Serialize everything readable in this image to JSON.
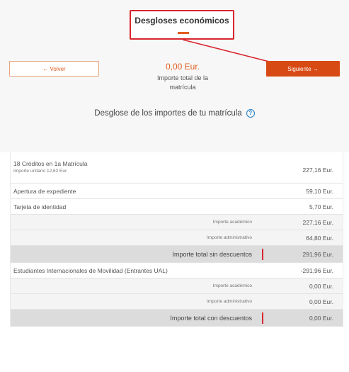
{
  "step": {
    "title": "Desgloses económicos"
  },
  "actions": {
    "back_label": "← Volver",
    "next_label": "Siguiente →"
  },
  "summary": {
    "total_amount": "0,00 Eur.",
    "total_caption": "Importe total de la matrícula"
  },
  "breakdown": {
    "title": "Desglose de los importes de tu matrícula",
    "help_glyph": "?",
    "rows": [
      {
        "label": "18 Créditos en 1a Matrícula",
        "sublabel": "Importe unitario 12,62 Eur.",
        "amount": "227,16 Eur."
      },
      {
        "label": "Apertura de expediente",
        "amount": "59,10 Eur."
      },
      {
        "label": "Tarjeta de identidad",
        "amount": "5,70 Eur."
      },
      {
        "label": "Importe académico",
        "amount": "227,16 Eur."
      },
      {
        "label": "Importe administrativo",
        "amount": "64,80 Eur."
      },
      {
        "label": "Importe total sin descuentos",
        "amount": "291,96 Eur."
      },
      {
        "label": "Estudiantes Internacionales de Movilidad (Entrantes UAL)",
        "amount": "-291,96 Eur."
      },
      {
        "label": "Importe académico",
        "amount": "0,00 Eur."
      },
      {
        "label": "Importe administrativo",
        "amount": "0,00 Eur."
      },
      {
        "label": "Importe total con descuentos",
        "amount": "0,00 Eur."
      }
    ]
  },
  "colors": {
    "accent": "#e15f1f",
    "annotation_red": "#d9262e",
    "link_blue": "#1f7dc9"
  }
}
